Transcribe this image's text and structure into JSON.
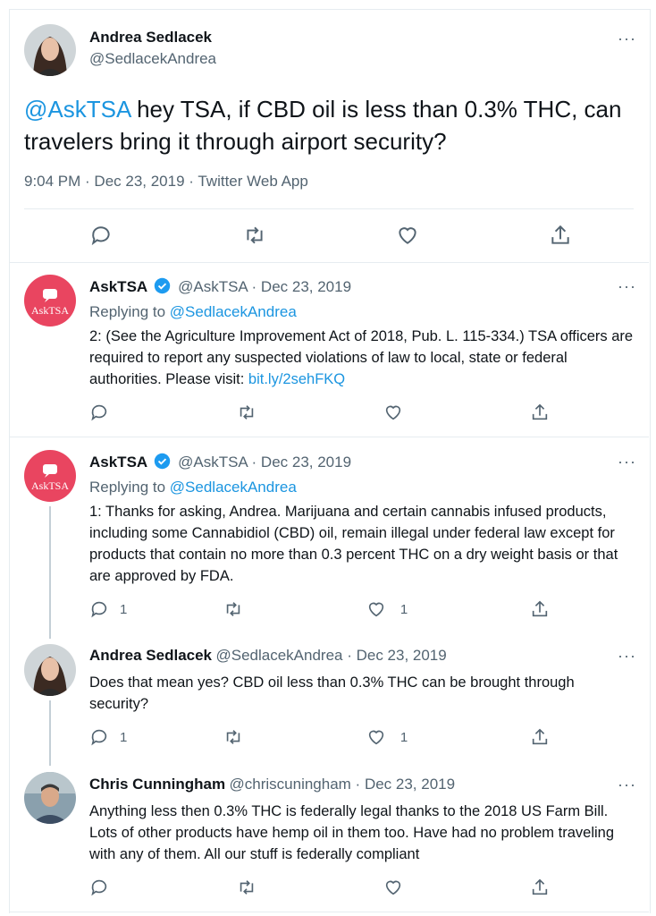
{
  "main_tweet": {
    "name": "Andrea Sedlacek",
    "handle": "@SedlacekAndrea",
    "mention": "@AskTSA",
    "text": " hey TSA, if CBD oil is less than 0.3% THC, can travelers bring it through airport security?",
    "meta": "9:04 PM · Dec 23, 2019 · Twitter Web App"
  },
  "replies": [
    {
      "name": "AskTSA",
      "handle_date": "@AskTSA · Dec 23, 2019",
      "replying_prefix": "Replying to ",
      "replying_to": "@SedlacekAndrea",
      "text": "2: (See the Agriculture Improvement Act of 2018, Pub. L. 115-334.)  TSA officers are required to report any suspected violations of law to local, state or federal authorities. Please visit: ",
      "link": "bit.ly/2sehFKQ",
      "reply_count": "",
      "like_count": ""
    },
    {
      "name": "AskTSA",
      "handle_date": "@AskTSA · Dec 23, 2019",
      "replying_prefix": "Replying to ",
      "replying_to": "@SedlacekAndrea",
      "text": "1: Thanks for asking, Andrea. Marijuana and certain cannabis infused products, including some Cannabidiol (CBD) oil, remain illegal under federal law except for products that contain no more than 0.3 percent THC on a dry weight basis or that are approved by FDA.",
      "reply_count": "1",
      "like_count": "1"
    },
    {
      "name": "Andrea Sedlacek",
      "handle_date": "@SedlacekAndrea · Dec 23, 2019",
      "text": "Does that mean yes? CBD oil less than 0.3% THC can be brought through security?",
      "reply_count": "1",
      "like_count": "1"
    },
    {
      "name": "Chris Cunningham",
      "handle_date": "@chriscuningham · Dec 23, 2019",
      "text": "Anything less then 0.3% THC is federally legal thanks to the 2018 US Farm Bill. Lots of other products have hemp oil in them too. Have had no problem traveling with any of them. All our stuff is federally compliant",
      "reply_count": "",
      "like_count": ""
    }
  ],
  "asktsa_avatar_label": "AskTSA",
  "more_label": "···",
  "colors": {
    "link": "#1b95e0",
    "verified": "#1d9bf0",
    "asktsa_bg": "#e94560",
    "muted": "#536471"
  }
}
